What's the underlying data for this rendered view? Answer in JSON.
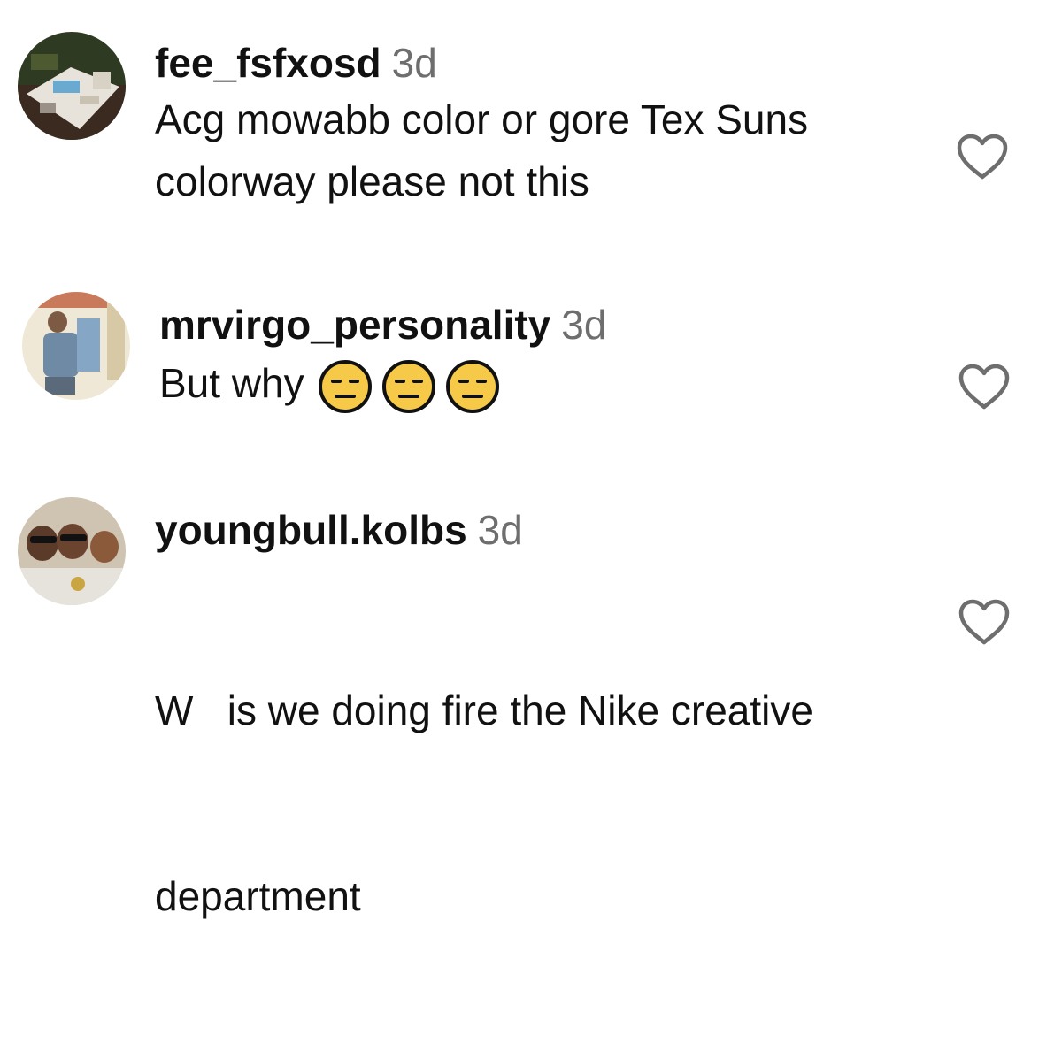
{
  "comments": [
    {
      "username": "fee_fsfxosd",
      "time": "3d",
      "text_lines": [
        "Acg mowabb color or gore Tex Suns",
        "colorway please not this"
      ],
      "avatar_icon": "avatar-photo-table"
    },
    {
      "username": "mrvirgo_personality",
      "time": "3d",
      "text": "But why",
      "emojis": [
        "expressionless-face-emoji",
        "expressionless-face-emoji",
        "expressionless-face-emoji"
      ],
      "avatar_icon": "avatar-photo-person"
    },
    {
      "username": "youngbull.kolbs",
      "time": "3d",
      "text_lines": [
        "W   is we doing fire the Nike creative",
        "department"
      ],
      "avatar_icon": "avatar-photo-group"
    }
  ],
  "colors": {
    "text": "#111111",
    "timestamp": "#6e6e6e",
    "heart_outline": "#6e6e6e",
    "emoji_fill": "#f7c948"
  },
  "like_icon": "heart-outline-icon"
}
